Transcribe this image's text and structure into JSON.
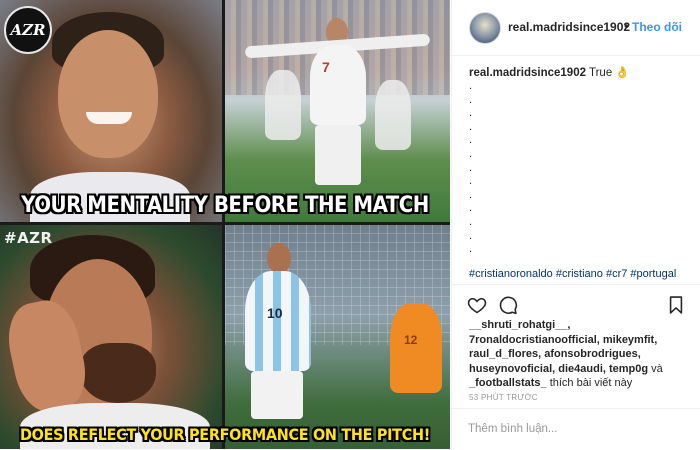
{
  "image": {
    "logo_text": "AZR",
    "watermark": "#AZR",
    "caption_top": "YOUR MENTALITY BEFORE THE MATCH",
    "caption_bottom": "DOES REFLECT YOUR PERFORMANCE ON THE PITCH!",
    "jersey_number_top": "7",
    "jersey_number_bottom": "10",
    "keeper_number": "12"
  },
  "header": {
    "username": "real.madridsince1902",
    "separator": "•",
    "follow_label": "Theo dõi"
  },
  "caption": {
    "username": "real.madridsince1902",
    "text": "True 👌",
    "dots": [
      ".",
      ".",
      ".",
      ".",
      ".",
      ".",
      ".",
      ".",
      ".",
      ".",
      ".",
      ".",
      "."
    ],
    "hashtags": "#cristianoronaldo #cristiano #cr7 #portugal"
  },
  "actions": {
    "like_icon": "heart-icon",
    "comment_icon": "comment-icon",
    "save_icon": "bookmark-icon"
  },
  "likes": {
    "users": "__shruti_rohatgi__, 7ronaldocristianoofficial, mikeymfit, raul_d_flores, afonsobrodrigues, huseynovoficial, die4audi, temp0g",
    "connector": "và",
    "last_user": "_footballstats_",
    "suffix": "thích bài viết này"
  },
  "timestamp": "53 PHÚT TRƯỚC",
  "comment_input": {
    "placeholder": "Thêm bình luận..."
  },
  "colors": {
    "follow": "#3897f0",
    "hashtag": "#003569",
    "muted": "#999999",
    "caption_bottom": "#ffe21a"
  }
}
